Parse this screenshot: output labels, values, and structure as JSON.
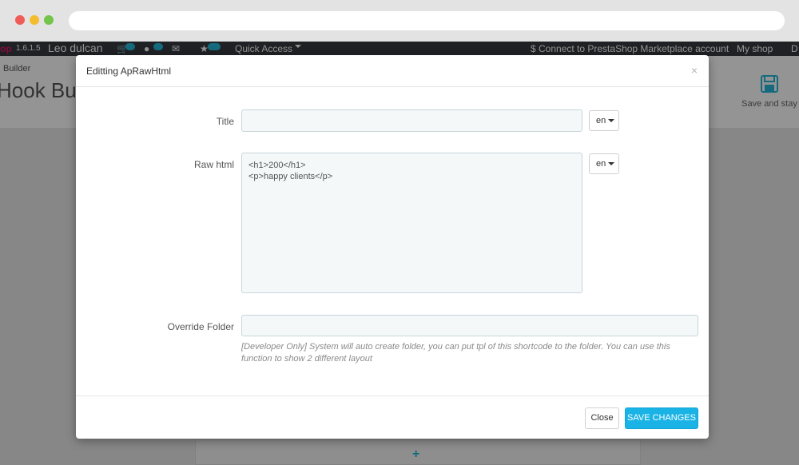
{
  "admin_header": {
    "logo_fragment": "op",
    "version": "1.6.1.5",
    "shop_owner": "Leo dulcan",
    "quick_access": "Quick Access",
    "connect_link": "Connect to PrestaShop Marketplace account",
    "my_shop": "My shop",
    "last_fragment": "D"
  },
  "page": {
    "breadcrumb": "Builder",
    "title_fragment": "Hook Bui",
    "save_and_stay": "Save and stay",
    "add_symbol": "+"
  },
  "modal": {
    "title": "Editting ApRawHtml",
    "close_symbol": "×",
    "fields": {
      "title_label": "Title",
      "title_value": "",
      "title_lang": "en",
      "raw_html_label": "Raw html",
      "raw_html_value": "<h1>200</h1>\n<p>happy clients</p>",
      "raw_html_lang": "en",
      "override_label": "Override Folder",
      "override_value": "",
      "override_help": "[Developer Only] System will auto create folder, you can put tpl of this shortcode to the folder. You can use this function to show 2 different layout"
    },
    "footer": {
      "close_label": "Close",
      "save_label": "SAVE CHANGES"
    }
  },
  "colors": {
    "primary_button": "#1ab3e6",
    "admin_bar": "#363a41",
    "input_bg": "#f4f8f9"
  }
}
